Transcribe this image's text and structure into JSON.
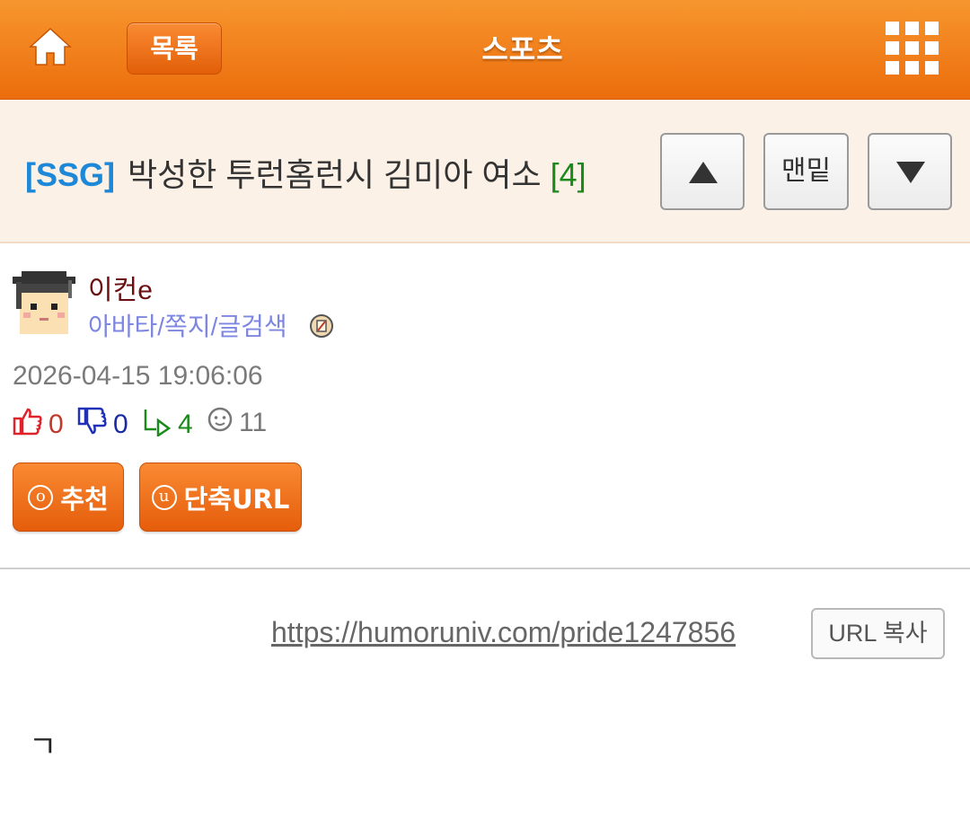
{
  "header": {
    "list_label": "목록",
    "board_title": "스포츠",
    "home_icon": "home-icon",
    "menu_icon": "grid-menu-icon"
  },
  "post": {
    "category": "[SSG]",
    "title": "박성한 투런홈런시 김미아 여소",
    "comment_count": "[4]",
    "nav": {
      "up_icon": "arrow-up-icon",
      "bottom_label": "맨밑",
      "down_icon": "arrow-down-icon"
    },
    "author": "이컨e",
    "author_links": "아바타/쪽지/글검색",
    "date": "2026-04-15 19:06:06",
    "stats": {
      "likes": "0",
      "dislikes": "0",
      "comments": "4",
      "views": "11"
    },
    "buttons": {
      "recommend": "추천",
      "recommend_symbol": "o",
      "short_url": "단축URL",
      "short_url_symbol": "u"
    },
    "url": "https://humoruniv.com/pride1247856",
    "url_copy_label": "URL 복사",
    "body": "ㄱ"
  },
  "colors": {
    "header_orange": "#ec6d0c",
    "title_bg": "#fcf1e6",
    "category_blue": "#1e88d8",
    "count_green": "#1a8a1a",
    "author_red": "#6b1010",
    "link_purple": "#7d86e0"
  }
}
